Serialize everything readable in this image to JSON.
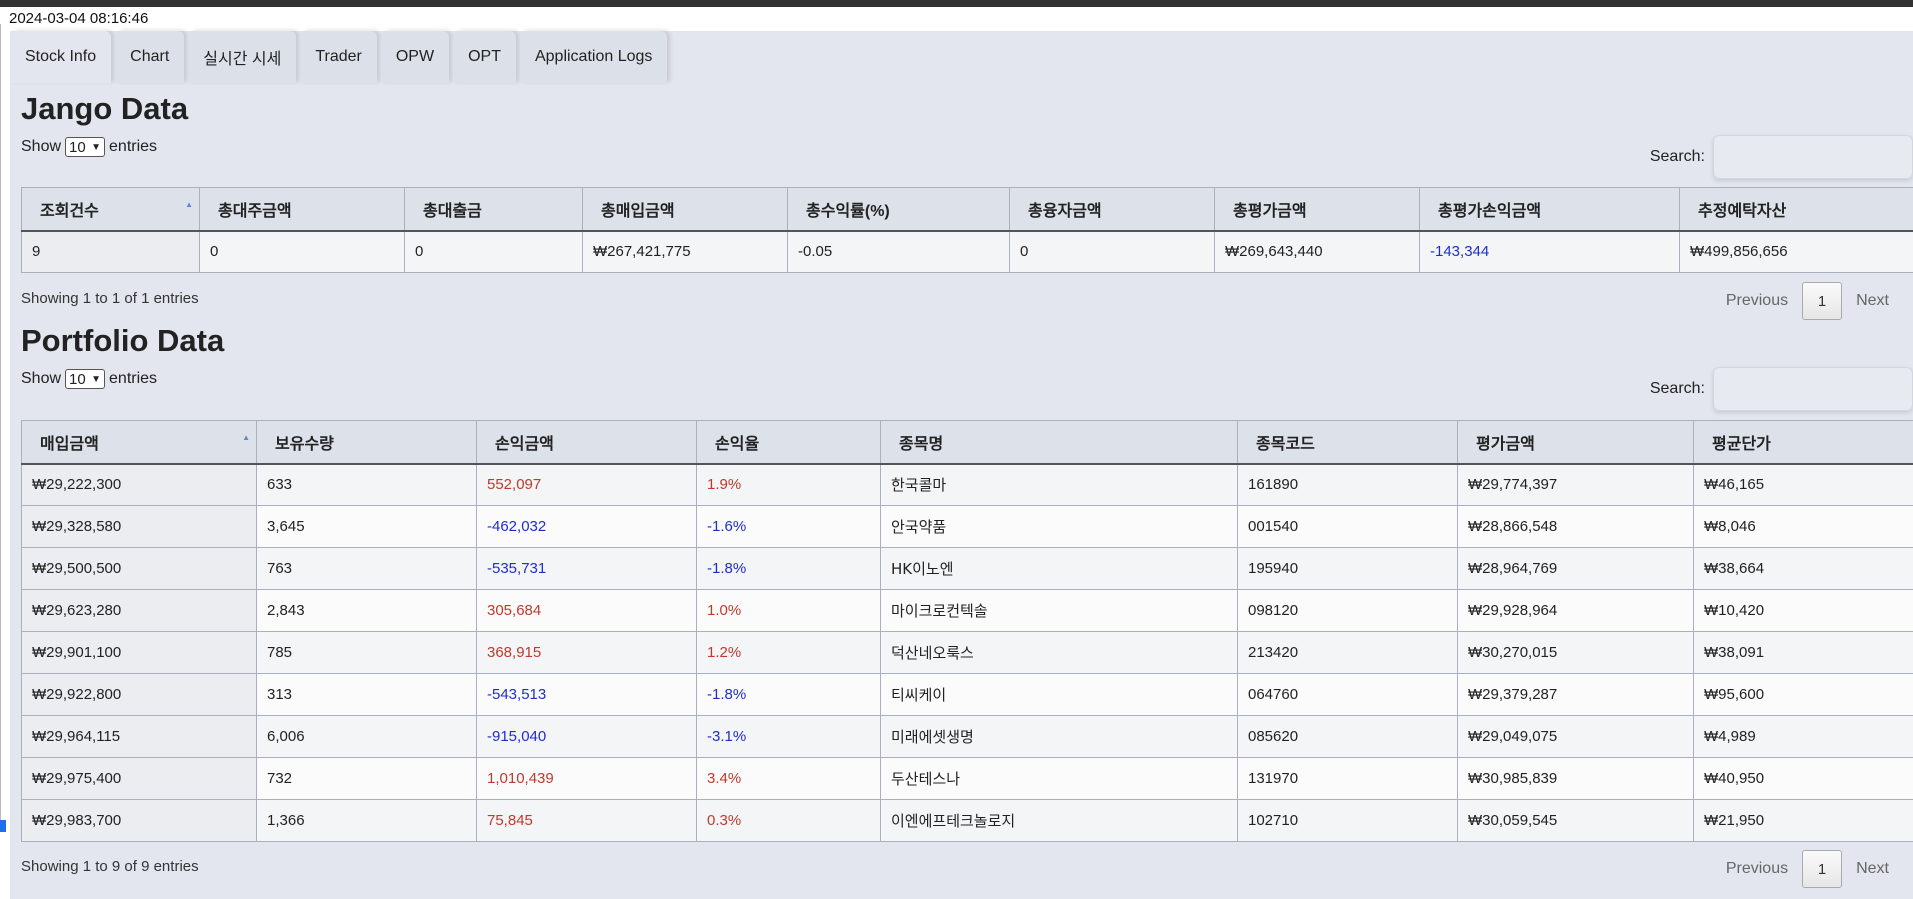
{
  "timestamp": "2024-03-04 08:16:46",
  "tabs": [
    "Stock Info",
    "Chart",
    "실시간 시세",
    "Trader",
    "OPW",
    "OPT",
    "Application Logs"
  ],
  "jango": {
    "title": "Jango Data",
    "show_label": "Show",
    "entries_value": "10",
    "entries_label": "entries",
    "search_label": "Search:",
    "columns": [
      "조회건수",
      "총대주금액",
      "총대출금",
      "총매입금액",
      "총수익률(%)",
      "총융자금액",
      "총평가금액",
      "총평가손익금액",
      "추정예탁자산"
    ],
    "rows": [
      [
        "9",
        "0",
        "0",
        "₩267,421,775",
        "-0.05",
        "0",
        "₩269,643,440",
        "-143,344",
        "₩499,856,656"
      ]
    ],
    "info": "Showing 1 to 1 of 1 entries",
    "prev": "Previous",
    "page": "1",
    "next": "Next"
  },
  "portfolio": {
    "title": "Portfolio Data",
    "show_label": "Show",
    "entries_value": "10",
    "entries_label": "entries",
    "search_label": "Search:",
    "columns": [
      "매입금액",
      "보유수량",
      "손익금액",
      "손익율",
      "종목명",
      "종목코드",
      "평가금액",
      "평균단가"
    ],
    "rows": [
      [
        "₩29,222,300",
        "633",
        "552,097",
        "1.9%",
        "한국콜마",
        "161890",
        "₩29,774,397",
        "₩46,165"
      ],
      [
        "₩29,328,580",
        "3,645",
        "-462,032",
        "-1.6%",
        "안국약품",
        "001540",
        "₩28,866,548",
        "₩8,046"
      ],
      [
        "₩29,500,500",
        "763",
        "-535,731",
        "-1.8%",
        "HK이노엔",
        "195940",
        "₩28,964,769",
        "₩38,664"
      ],
      [
        "₩29,623,280",
        "2,843",
        "305,684",
        "1.0%",
        "마이크로컨텍솔",
        "098120",
        "₩29,928,964",
        "₩10,420"
      ],
      [
        "₩29,901,100",
        "785",
        "368,915",
        "1.2%",
        "덕산네오룩스",
        "213420",
        "₩30,270,015",
        "₩38,091"
      ],
      [
        "₩29,922,800",
        "313",
        "-543,513",
        "-1.8%",
        "티씨케이",
        "064760",
        "₩29,379,287",
        "₩95,600"
      ],
      [
        "₩29,964,115",
        "6,006",
        "-915,040",
        "-3.1%",
        "미래에셋생명",
        "085620",
        "₩29,049,075",
        "₩4,989"
      ],
      [
        "₩29,975,400",
        "732",
        "1,010,439",
        "3.4%",
        "두산테스나",
        "131970",
        "₩30,985,839",
        "₩40,950"
      ],
      [
        "₩29,983,700",
        "1,366",
        "75,845",
        "0.3%",
        "이엔에프테크놀로지",
        "102710",
        "₩30,059,545",
        "₩21,950"
      ]
    ],
    "info": "Showing 1 to 9 of 9 entries",
    "prev": "Previous",
    "page": "1",
    "next": "Next"
  },
  "colors": {
    "positive": "#c0392b",
    "negative": "#1f2ec9",
    "panel": "#e3e6ee"
  }
}
